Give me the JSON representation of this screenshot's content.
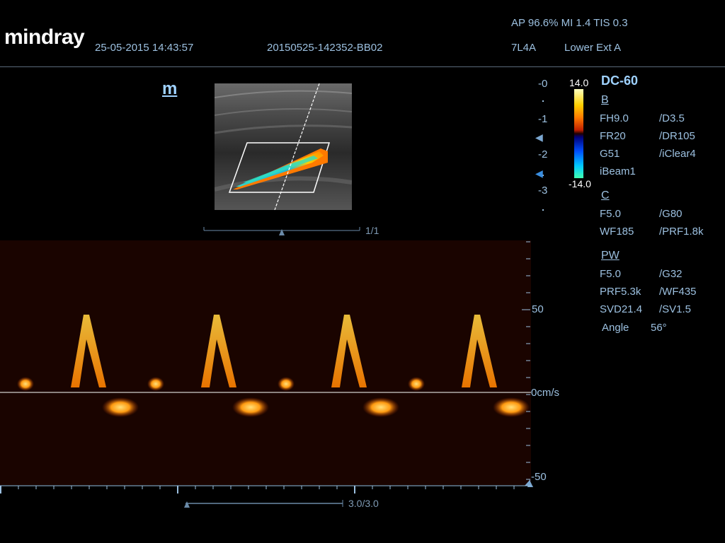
{
  "header": {
    "logo": "mindray",
    "datetime": "25-05-2015 14:43:57",
    "patient_id": "20150525-142352-BB02",
    "power_info": "AP 96.6%  MI 1.4 TIS 0.3",
    "probe": "7L4A",
    "exam": "Lower Ext A"
  },
  "image_mode_label": "m",
  "frame_counter": "1/1",
  "depth_scale": [
    "0",
    "1",
    "2",
    "3"
  ],
  "colorbar": {
    "max": "14.0",
    "min": "-14.0"
  },
  "preset": "DC-60",
  "params": {
    "b_title": "B",
    "b": [
      [
        "FH9.0",
        "/D3.5"
      ],
      [
        "FR20",
        "/DR105"
      ],
      [
        "G51",
        "/iClear4"
      ],
      [
        "iBeam1",
        ""
      ]
    ],
    "c_title": "C",
    "c": [
      [
        "F5.0",
        "/G80"
      ],
      [
        "WF185",
        "/PRF1.8k"
      ]
    ],
    "pw_title": "PW",
    "pw": [
      [
        "F5.0",
        "/G32"
      ],
      [
        "PRF5.3k",
        "/WF435"
      ],
      [
        "SVD21.4",
        "/SV1.5"
      ]
    ],
    "angle_label": "Angle",
    "angle_value": "56°"
  },
  "velocity_scale": {
    "top": "50",
    "zero": "0cm/s",
    "bottom": "-50"
  },
  "sweep_speed": "3.0/3.0",
  "colors": {
    "text": "#9cc0e0",
    "accent": "#9fd2ff",
    "background": "#000000",
    "spectral_bg": "#1a0400"
  }
}
